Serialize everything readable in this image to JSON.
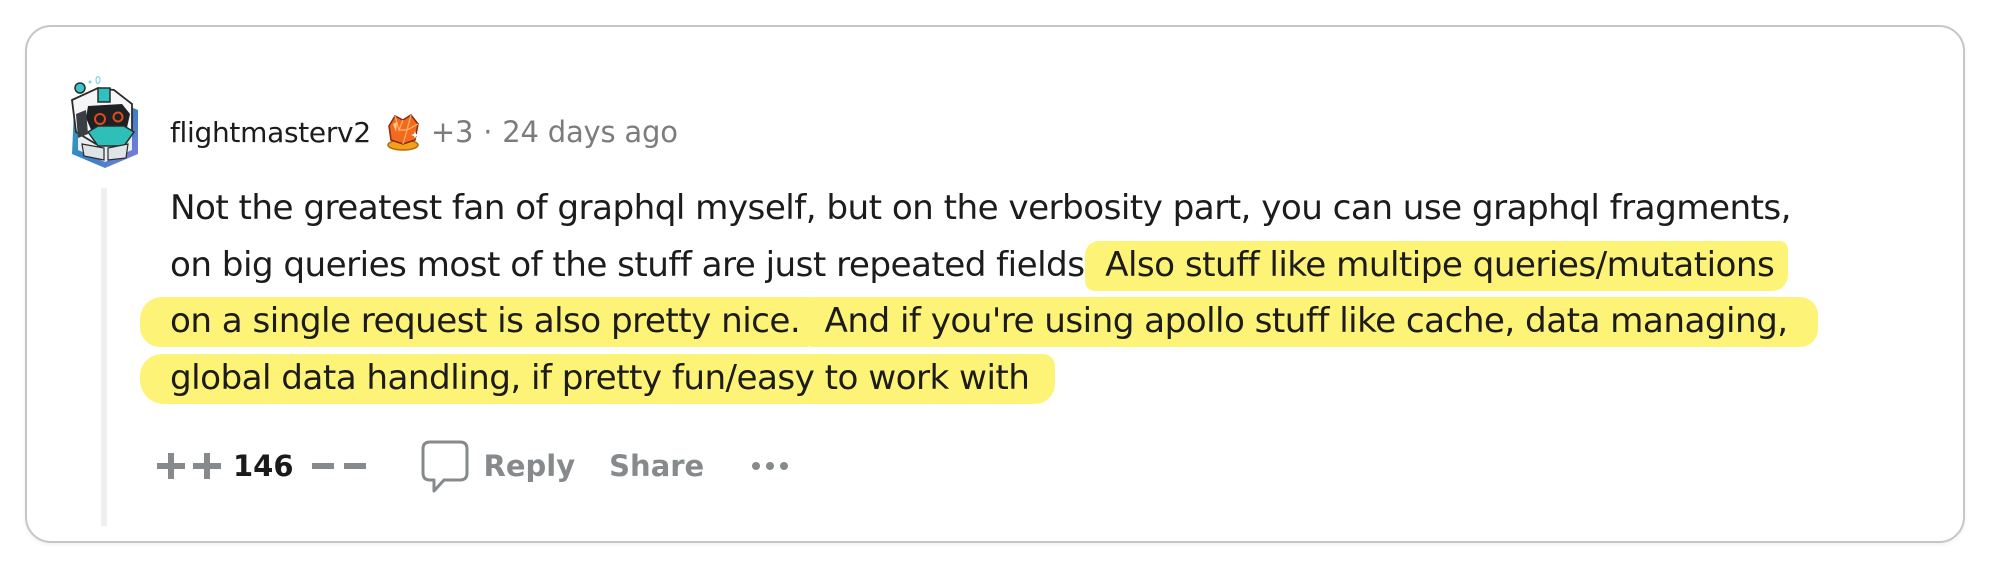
{
  "comment": {
    "author": {
      "username": "flightmasterv2",
      "avatar_icon": "robot-avatar-icon",
      "flair_icon": "orange-crystal-award-icon",
      "award_extra": "+3",
      "separator": "·",
      "timestamp": "24 days ago"
    },
    "body": {
      "lines": [
        [
          {
            "text": "Not the greatest fan of graphql myself, but on the verbosity part, you can use graphql fragments,",
            "highlighted": false
          }
        ],
        [
          {
            "text": "on big queries most of the stuff are just repeated fields.",
            "highlighted": false
          },
          {
            "text": " Also stuff like multipe queries/mutations",
            "highlighted": true
          }
        ],
        [
          {
            "text": "on a single request is also pretty nice.",
            "highlighted": true
          },
          {
            "text": " And if you're using apollo stuff like cache, data managing,",
            "highlighted": true
          }
        ],
        [
          {
            "text": "global data handling, if pretty fun/easy to work with",
            "highlighted": true
          }
        ]
      ],
      "highlight_color": "#fdf377"
    },
    "actions": {
      "upvote_icon": "double-plus-icon",
      "score": "146",
      "downvote_icon": "double-minus-icon",
      "reply_icon": "speech-bubble-icon",
      "reply_label": "Reply",
      "share_label": "Share",
      "more_icon": "ellipsis-icon"
    }
  }
}
